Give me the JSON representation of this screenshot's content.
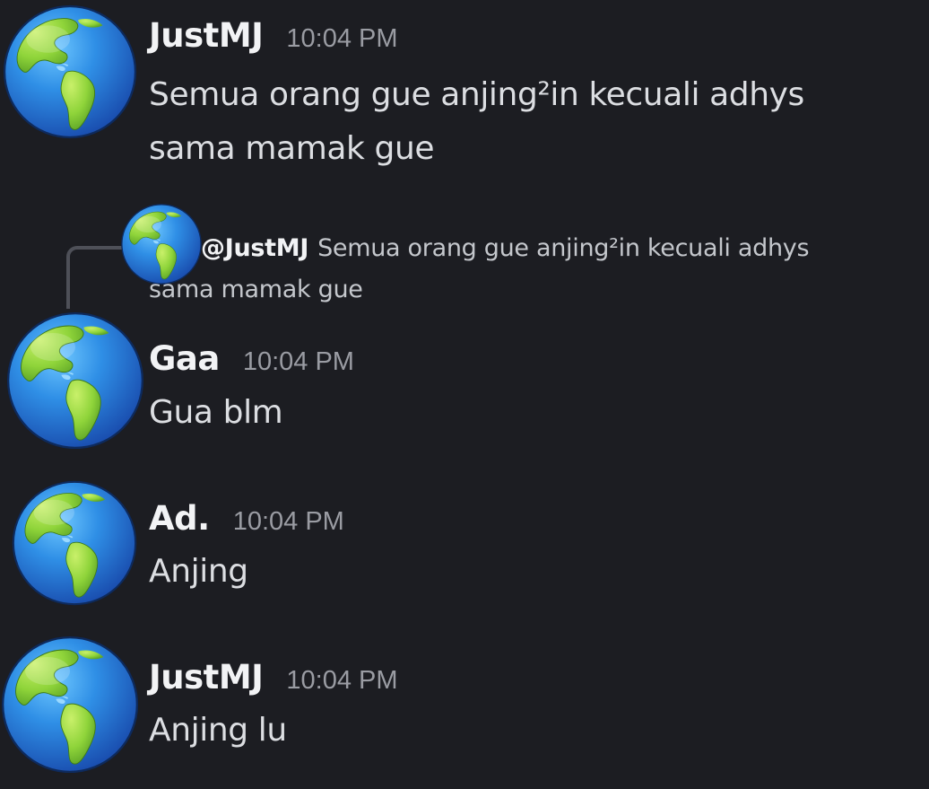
{
  "colors": {
    "background": "#1c1d22",
    "username": "#f2f3f5",
    "timestamp": "#9a9ca3",
    "message_text": "#dcdee2",
    "reply_spine": "#4e5058"
  },
  "messages": [
    {
      "avatar_icon": "earth-globe-americas-icon",
      "username": "JustMJ",
      "timestamp": "10:04 PM",
      "text_lines": [
        "Semua orang gue anjing²in kecuali adhys",
        "sama mamak gue"
      ]
    },
    {
      "reply": {
        "avatar_icon": "earth-globe-americas-icon",
        "mention": "@JustMJ",
        "text": "Semua orang gue anjing²in kecuali adhys sama mamak gue"
      },
      "avatar_icon": "earth-globe-americas-icon",
      "username": "Gaa",
      "timestamp": "10:04 PM",
      "text_lines": [
        "Gua blm"
      ]
    },
    {
      "avatar_icon": "earth-globe-americas-icon",
      "username": "Ad.",
      "timestamp": "10:04 PM",
      "text_lines": [
        "Anjing"
      ]
    },
    {
      "avatar_icon": "earth-globe-americas-icon",
      "username": "JustMJ",
      "timestamp": "10:04 PM",
      "text_lines": [
        "Anjing lu"
      ]
    }
  ]
}
